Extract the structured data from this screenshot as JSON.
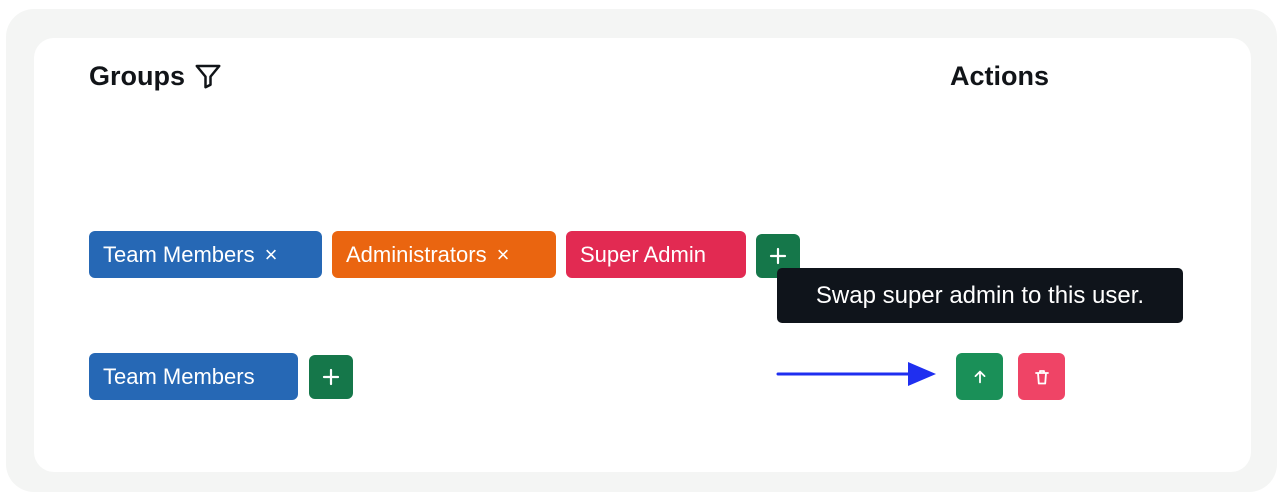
{
  "table": {
    "groups_header": "Groups",
    "actions_header": "Actions"
  },
  "row1": {
    "tags": [
      {
        "label": "Team Members",
        "remove": "×",
        "color": "#2668b5"
      },
      {
        "label": "Administrators",
        "remove": "×",
        "color": "#ea6510"
      },
      {
        "label": "Super Admin",
        "color": "#e22a52"
      }
    ],
    "add_label": "+"
  },
  "tooltip": {
    "text": "Swap super admin to this user."
  },
  "row2": {
    "tags": [
      {
        "label": "Team Members",
        "color": "#2668b5"
      }
    ],
    "add_label": "+"
  },
  "icons": {
    "filter": "filter-icon",
    "plus": "plus-icon",
    "arrow_up": "arrow-up-icon",
    "trash": "trash-icon",
    "annotation_arrow": "arrow-right-icon"
  },
  "colors": {
    "tag_blue": "#2668b5",
    "tag_orange": "#ea6510",
    "tag_red": "#e22a52",
    "add_green": "#15774a",
    "swap_green": "#1a9058",
    "delete_red": "#ef4466",
    "tooltip_bg": "#0f141b",
    "annotation_arrow": "#1f2ff0"
  }
}
